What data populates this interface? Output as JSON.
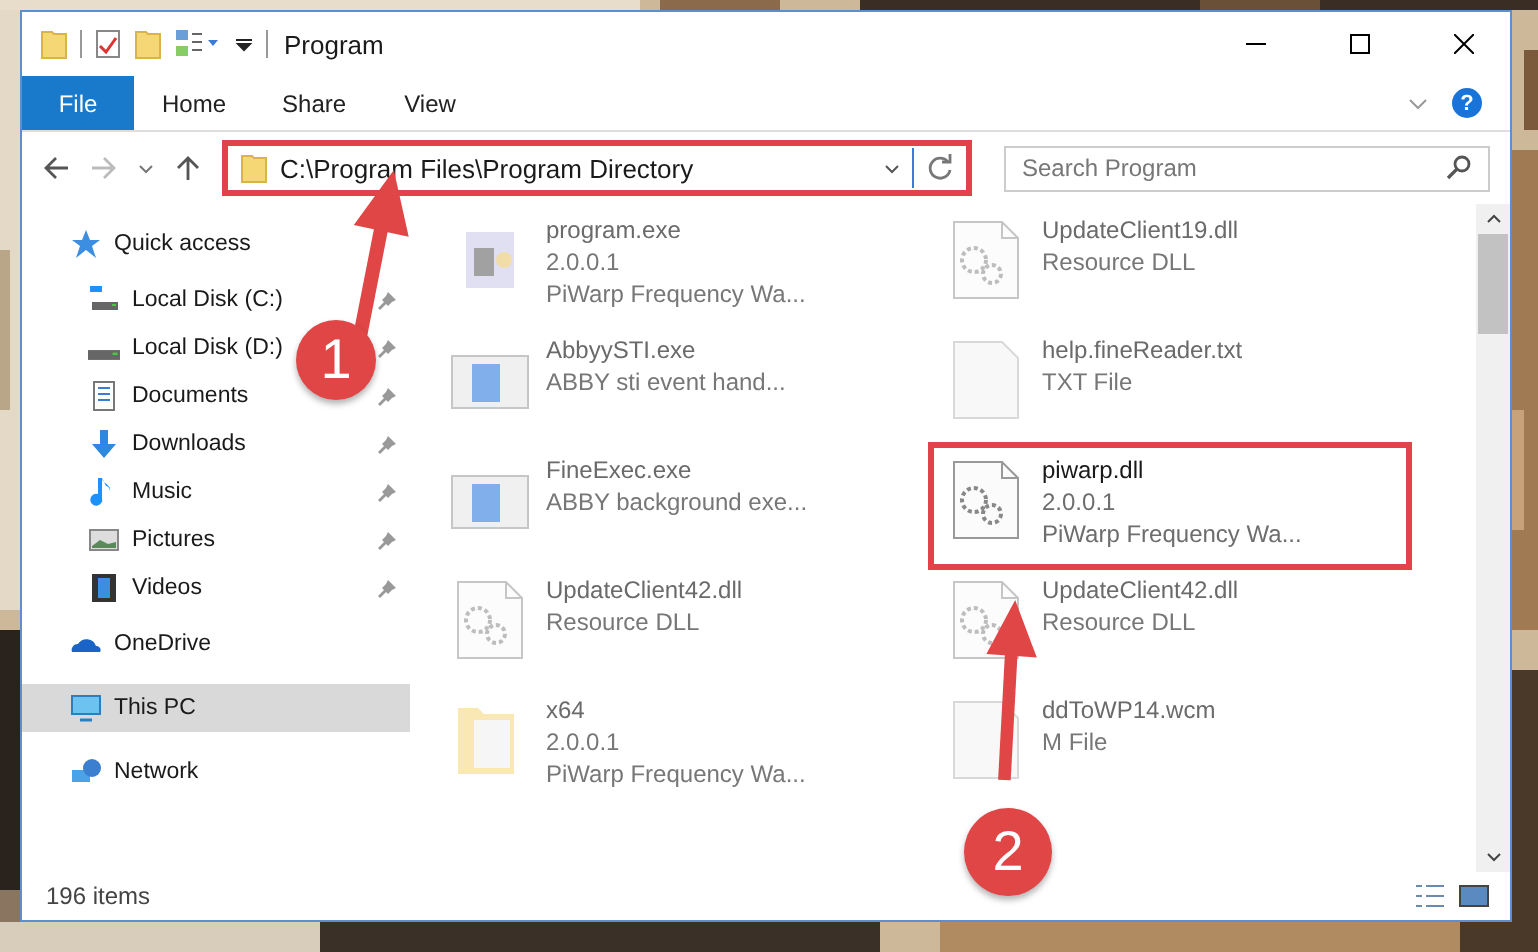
{
  "window": {
    "title": "Program",
    "help": "?"
  },
  "ribbon_tabs": [
    {
      "label": "File",
      "selected": true
    },
    {
      "label": "Home",
      "selected": false
    },
    {
      "label": "Share",
      "selected": false
    },
    {
      "label": "View",
      "selected": false
    }
  ],
  "address": {
    "path": "C:\\Program Files\\Program Directory"
  },
  "search": {
    "placeholder": "Search Program"
  },
  "sidebar": {
    "items": [
      {
        "label": "Quick access",
        "kind": "star",
        "selected": false,
        "children": [
          {
            "label": "Local Disk (C:)",
            "kind": "disk-c",
            "pinned": true,
            "selected": false
          },
          {
            "label": "Local Disk (D:)",
            "kind": "disk",
            "pinned": true,
            "selected": false
          },
          {
            "label": "Documents",
            "kind": "docs",
            "pinned": true,
            "selected": false
          },
          {
            "label": "Downloads",
            "kind": "download",
            "pinned": true,
            "selected": false
          },
          {
            "label": "Music",
            "kind": "music",
            "pinned": true,
            "selected": false
          },
          {
            "label": "Pictures",
            "kind": "pictures",
            "pinned": true,
            "selected": false
          },
          {
            "label": "Videos",
            "kind": "videos",
            "pinned": true,
            "selected": false
          }
        ]
      },
      {
        "label": "OneDrive",
        "kind": "cloud",
        "selected": false
      },
      {
        "label": "This PC",
        "kind": "pc",
        "selected": true
      },
      {
        "label": "Network",
        "kind": "network",
        "selected": false
      }
    ]
  },
  "files": [
    {
      "name": "program.exe",
      "details": [
        "2.0.0.1",
        "PiWarp Frequency Wa..."
      ],
      "kind": "exe",
      "highlighted": false
    },
    {
      "name": "UpdateClient19.dll",
      "details": [
        "Resource DLL"
      ],
      "kind": "dll",
      "highlighted": false
    },
    {
      "name": "AbbyySTI.exe",
      "details": [
        "ABBY sti event hand..."
      ],
      "kind": "app",
      "highlighted": false
    },
    {
      "name": "help.fineReader.txt",
      "details": [
        "TXT File"
      ],
      "kind": "txt",
      "highlighted": false
    },
    {
      "name": "FineExec.exe",
      "details": [
        "ABBY background exe..."
      ],
      "kind": "app",
      "highlighted": false
    },
    {
      "name": "piwarp.dll",
      "details": [
        "2.0.0.1",
        "PiWarp Frequency Wa..."
      ],
      "kind": "dll",
      "highlighted": true
    },
    {
      "name": "UpdateClient42.dll",
      "details": [
        "Resource DLL"
      ],
      "kind": "dll",
      "highlighted": false
    },
    {
      "name": "UpdateClient42.dll",
      "details": [
        "Resource DLL"
      ],
      "kind": "dll",
      "highlighted": false
    },
    {
      "name": "x64",
      "details": [
        "2.0.0.1",
        "PiWarp Frequency Wa..."
      ],
      "kind": "folder",
      "highlighted": false
    },
    {
      "name": "ddToWP14.wcm",
      "details": [
        "M File"
      ],
      "kind": "txt",
      "highlighted": false
    }
  ],
  "status_bar": {
    "count": "196 items"
  },
  "annotations": [
    {
      "number": "1"
    },
    {
      "number": "2"
    }
  ]
}
